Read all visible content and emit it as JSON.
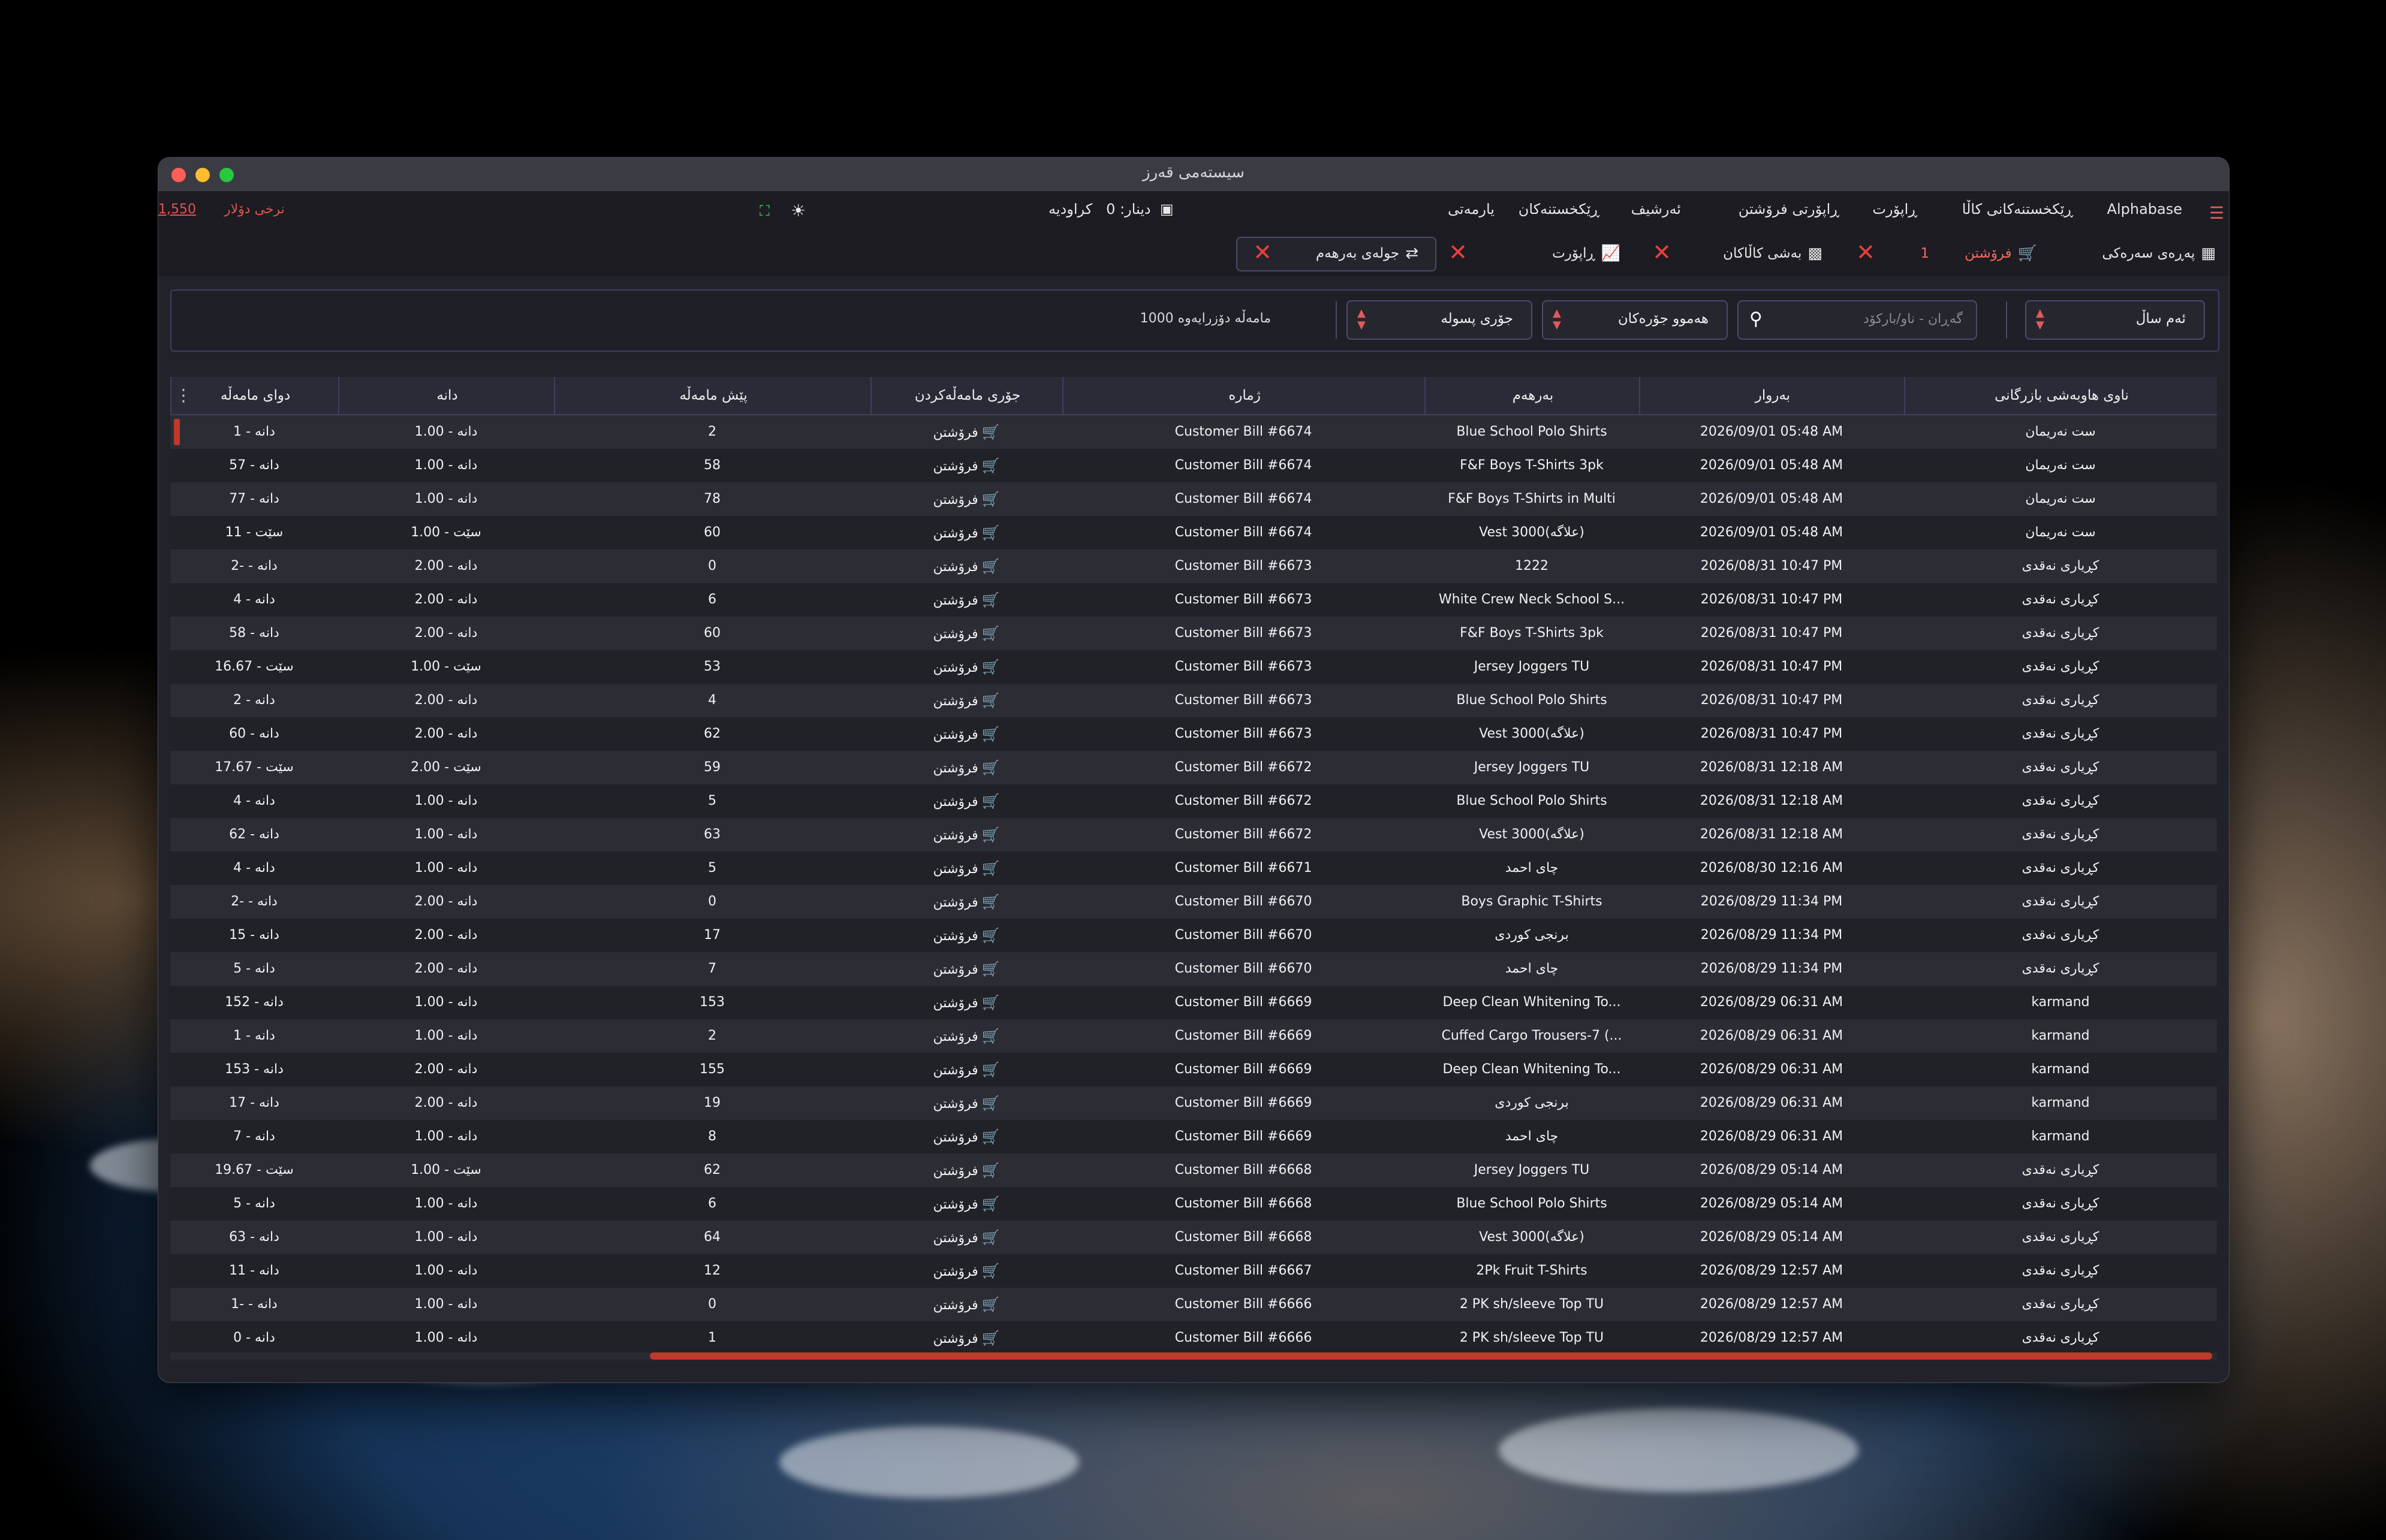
{
  "window": {
    "title": "سیستەمی قەرز"
  },
  "menu": {
    "items": [
      "Alphabase",
      "ڕێکخستنەکانی کاڵا",
      "ڕاپۆرت",
      "ڕاپۆرتی فرۆشتن",
      "ئەرشیف",
      "ڕێکخستنەکان",
      "یارمەتی"
    ],
    "cash_label": "کراودیە",
    "dinar_label": "دینار: 0",
    "dollar_rate_label": "نرخی دۆلار",
    "dollar_rate_value": "1,550"
  },
  "tabs": {
    "home": "پەڕەی سەرەکی",
    "sales": "فرۆشتن",
    "sales_count": "1",
    "goods": "بەشی کاڵاکان",
    "report": "ڕاپۆرت",
    "movement": "جولەی بەرهەم"
  },
  "filters": {
    "year": "ئەم ساڵ",
    "search_placeholder": "گەڕان - ناو/بارکۆد",
    "all_types": "هەموو جۆرەکان",
    "bill_type": "جۆری پسوله",
    "count_text": "1000 مامەڵە دۆزرایەوە"
  },
  "table": {
    "columns": [
      "ناوی هاوبەشی بازرگانی",
      "بەروار",
      "بەرهەم",
      "ژمارە",
      "جۆری مامەڵەکردن",
      "پێش مامەڵە",
      "دانە",
      "دوای مامەڵە"
    ],
    "rows": [
      {
        "partner": "ست نەریمان",
        "date": "2026/09/01 05:48 AM",
        "product": "Blue School Polo Shirts",
        "bill": "Customer Bill #6674",
        "type": "فرۆشتن",
        "before": "2",
        "qty": "1.00",
        "qty_unit": "دانە",
        "after": "1",
        "after_unit": "دانە"
      },
      {
        "partner": "ست نەریمان",
        "date": "2026/09/01 05:48 AM",
        "product": "F&F Boys T-Shirts 3pk",
        "bill": "Customer Bill #6674",
        "type": "فرۆشتن",
        "before": "58",
        "qty": "1.00",
        "qty_unit": "دانە",
        "after": "57",
        "after_unit": "دانە"
      },
      {
        "partner": "ست نەریمان",
        "date": "2026/09/01 05:48 AM",
        "product": "F&F Boys T-Shirts in Multi",
        "bill": "Customer Bill #6674",
        "type": "فرۆشتن",
        "before": "78",
        "qty": "1.00",
        "qty_unit": "دانە",
        "after": "77",
        "after_unit": "دانە"
      },
      {
        "partner": "ست نەریمان",
        "date": "2026/09/01 05:48 AM",
        "product": "Vest 3000(علاگە)",
        "bill": "Customer Bill #6674",
        "type": "فرۆشتن",
        "before": "60",
        "qty": "1.00",
        "qty_unit": "سێت",
        "after": "11",
        "after_unit": "سێت"
      },
      {
        "partner": "کڕیاری نەقدی",
        "date": "2026/08/31 10:47 PM",
        "product": "1222",
        "bill": "Customer Bill #6673",
        "type": "فرۆشتن",
        "before": "0",
        "qty": "2.00",
        "qty_unit": "دانە",
        "after": "-2",
        "after_unit": "دانە"
      },
      {
        "partner": "کڕیاری نەقدی",
        "date": "2026/08/31 10:47 PM",
        "product": "White Crew Neck School S...",
        "bill": "Customer Bill #6673",
        "type": "فرۆشتن",
        "before": "6",
        "qty": "2.00",
        "qty_unit": "دانە",
        "after": "4",
        "after_unit": "دانە"
      },
      {
        "partner": "کڕیاری نەقدی",
        "date": "2026/08/31 10:47 PM",
        "product": "F&F Boys T-Shirts 3pk",
        "bill": "Customer Bill #6673",
        "type": "فرۆشتن",
        "before": "60",
        "qty": "2.00",
        "qty_unit": "دانە",
        "after": "58",
        "after_unit": "دانە"
      },
      {
        "partner": "کڕیاری نەقدی",
        "date": "2026/08/31 10:47 PM",
        "product": "Jersey Joggers TU",
        "bill": "Customer Bill #6673",
        "type": "فرۆشتن",
        "before": "53",
        "qty": "1.00",
        "qty_unit": "سێت",
        "after": "16.67",
        "after_unit": "سێت"
      },
      {
        "partner": "کڕیاری نەقدی",
        "date": "2026/08/31 10:47 PM",
        "product": "Blue School Polo Shirts",
        "bill": "Customer Bill #6673",
        "type": "فرۆشتن",
        "before": "4",
        "qty": "2.00",
        "qty_unit": "دانە",
        "after": "2",
        "after_unit": "دانە"
      },
      {
        "partner": "کڕیاری نەقدی",
        "date": "2026/08/31 10:47 PM",
        "product": "Vest 3000(علاگە)",
        "bill": "Customer Bill #6673",
        "type": "فرۆشتن",
        "before": "62",
        "qty": "2.00",
        "qty_unit": "دانە",
        "after": "60",
        "after_unit": "دانە"
      },
      {
        "partner": "کڕیاری نەقدی",
        "date": "2026/08/31 12:18 AM",
        "product": "Jersey Joggers TU",
        "bill": "Customer Bill #6672",
        "type": "فرۆشتن",
        "before": "59",
        "qty": "2.00",
        "qty_unit": "سێت",
        "after": "17.67",
        "after_unit": "سێت"
      },
      {
        "partner": "کڕیاری نەقدی",
        "date": "2026/08/31 12:18 AM",
        "product": "Blue School Polo Shirts",
        "bill": "Customer Bill #6672",
        "type": "فرۆشتن",
        "before": "5",
        "qty": "1.00",
        "qty_unit": "دانە",
        "after": "4",
        "after_unit": "دانە"
      },
      {
        "partner": "کڕیاری نەقدی",
        "date": "2026/08/31 12:18 AM",
        "product": "Vest 3000(علاگە)",
        "bill": "Customer Bill #6672",
        "type": "فرۆشتن",
        "before": "63",
        "qty": "1.00",
        "qty_unit": "دانە",
        "after": "62",
        "after_unit": "دانە"
      },
      {
        "partner": "کڕیاری نەقدی",
        "date": "2026/08/30 12:16 AM",
        "product": "چای احمد",
        "bill": "Customer Bill #6671",
        "type": "فرۆشتن",
        "before": "5",
        "qty": "1.00",
        "qty_unit": "دانە",
        "after": "4",
        "after_unit": "دانە"
      },
      {
        "partner": "کڕیاری نەقدی",
        "date": "2026/08/29 11:34 PM",
        "product": "Boys Graphic T-Shirts",
        "bill": "Customer Bill #6670",
        "type": "فرۆشتن",
        "before": "0",
        "qty": "2.00",
        "qty_unit": "دانە",
        "after": "-2",
        "after_unit": "دانە"
      },
      {
        "partner": "کڕیاری نەقدی",
        "date": "2026/08/29 11:34 PM",
        "product": "برنجی کوردی",
        "bill": "Customer Bill #6670",
        "type": "فرۆشتن",
        "before": "17",
        "qty": "2.00",
        "qty_unit": "دانە",
        "after": "15",
        "after_unit": "دانە"
      },
      {
        "partner": "کڕیاری نەقدی",
        "date": "2026/08/29 11:34 PM",
        "product": "چای احمد",
        "bill": "Customer Bill #6670",
        "type": "فرۆشتن",
        "before": "7",
        "qty": "2.00",
        "qty_unit": "دانە",
        "after": "5",
        "after_unit": "دانە"
      },
      {
        "partner": "karmand",
        "date": "2026/08/29 06:31 AM",
        "product": "Deep Clean Whitening To...",
        "bill": "Customer Bill #6669",
        "type": "فرۆشتن",
        "before": "153",
        "qty": "1.00",
        "qty_unit": "دانە",
        "after": "152",
        "after_unit": "دانە"
      },
      {
        "partner": "karmand",
        "date": "2026/08/29 06:31 AM",
        "product": "Cuffed Cargo Trousers-7 (...",
        "bill": "Customer Bill #6669",
        "type": "فرۆشتن",
        "before": "2",
        "qty": "1.00",
        "qty_unit": "دانە",
        "after": "1",
        "after_unit": "دانە"
      },
      {
        "partner": "karmand",
        "date": "2026/08/29 06:31 AM",
        "product": "Deep Clean Whitening To...",
        "bill": "Customer Bill #6669",
        "type": "فرۆشتن",
        "before": "155",
        "qty": "2.00",
        "qty_unit": "دانە",
        "after": "153",
        "after_unit": "دانە"
      },
      {
        "partner": "karmand",
        "date": "2026/08/29 06:31 AM",
        "product": "برنجی کوردی",
        "bill": "Customer Bill #6669",
        "type": "فرۆشتن",
        "before": "19",
        "qty": "2.00",
        "qty_unit": "دانە",
        "after": "17",
        "after_unit": "دانە"
      },
      {
        "partner": "karmand",
        "date": "2026/08/29 06:31 AM",
        "product": "چای احمد",
        "bill": "Customer Bill #6669",
        "type": "فرۆشتن",
        "before": "8",
        "qty": "1.00",
        "qty_unit": "دانە",
        "after": "7",
        "after_unit": "دانە"
      },
      {
        "partner": "کڕیاری نەقدی",
        "date": "2026/08/29 05:14 AM",
        "product": "Jersey Joggers TU",
        "bill": "Customer Bill #6668",
        "type": "فرۆشتن",
        "before": "62",
        "qty": "1.00",
        "qty_unit": "سێت",
        "after": "19.67",
        "after_unit": "سێت"
      },
      {
        "partner": "کڕیاری نەقدی",
        "date": "2026/08/29 05:14 AM",
        "product": "Blue School Polo Shirts",
        "bill": "Customer Bill #6668",
        "type": "فرۆشتن",
        "before": "6",
        "qty": "1.00",
        "qty_unit": "دانە",
        "after": "5",
        "after_unit": "دانە"
      },
      {
        "partner": "کڕیاری نەقدی",
        "date": "2026/08/29 05:14 AM",
        "product": "Vest 3000(علاگە)",
        "bill": "Customer Bill #6668",
        "type": "فرۆشتن",
        "before": "64",
        "qty": "1.00",
        "qty_unit": "دانە",
        "after": "63",
        "after_unit": "دانە"
      },
      {
        "partner": "کڕیاری نەقدی",
        "date": "2026/08/29 12:57 AM",
        "product": "2Pk  Fruit T-Shirts",
        "bill": "Customer Bill #6667",
        "type": "فرۆشتن",
        "before": "12",
        "qty": "1.00",
        "qty_unit": "دانە",
        "after": "11",
        "after_unit": "دانە"
      },
      {
        "partner": "کڕیاری نەقدی",
        "date": "2026/08/29 12:57 AM",
        "product": "2 PK sh/sleeve Top TU",
        "bill": "Customer Bill #6666",
        "type": "فرۆشتن",
        "before": "0",
        "qty": "1.00",
        "qty_unit": "دانە",
        "after": "-1",
        "after_unit": "دانە"
      },
      {
        "partner": "کڕیاری نەقدی",
        "date": "2026/08/29 12:57 AM",
        "product": "2 PK sh/sleeve Top TU",
        "bill": "Customer Bill #6666",
        "type": "فرۆشتن",
        "before": "1",
        "qty": "1.00",
        "qty_unit": "دانە",
        "after": "0",
        "after_unit": "دانە"
      }
    ]
  },
  "colors": {
    "accent": "#e0544f",
    "window_bg": "#22222a",
    "row_even": "#2c2c35",
    "row_odd": "#212128"
  }
}
